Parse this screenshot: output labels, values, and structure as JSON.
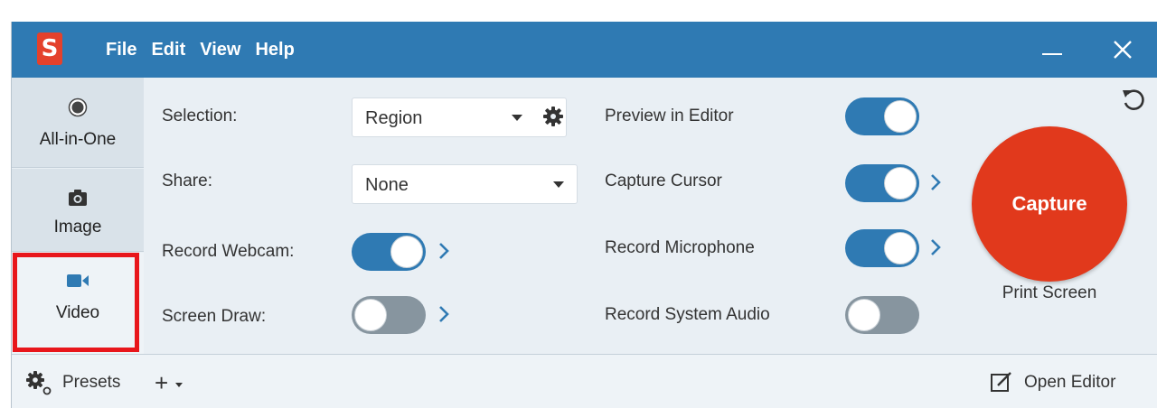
{
  "titlebar": {
    "logo": "S",
    "menu": [
      "File",
      "Edit",
      "View",
      "Help"
    ],
    "minimize_icon": "minimize-icon",
    "close_icon": "close-icon",
    "color": "#2f7ab3"
  },
  "modes": {
    "items": [
      {
        "label": "All-in-One",
        "icon": "record-dot-icon"
      },
      {
        "label": "Image",
        "icon": "camera-icon"
      },
      {
        "label": "Video",
        "icon": "video-camera-icon",
        "selected": true
      }
    ],
    "highlight_color": "#e8161b"
  },
  "settings": {
    "selection": {
      "label": "Selection:",
      "value": "Region"
    },
    "share": {
      "label": "Share:",
      "value": "None"
    },
    "record_webcam": {
      "label": "Record Webcam:",
      "on": true
    },
    "screen_draw": {
      "label": "Screen Draw:",
      "on": false
    },
    "preview_in_editor": {
      "label": "Preview in Editor",
      "on": true
    },
    "capture_cursor": {
      "label": "Capture Cursor",
      "on": true
    },
    "record_microphone": {
      "label": "Record Microphone",
      "on": true
    },
    "record_system_audio": {
      "label": "Record System Audio",
      "on": false
    }
  },
  "capture": {
    "label": "Capture",
    "hotkey": "Print Screen",
    "color": "#e1391c"
  },
  "bottombar": {
    "presets_label": "Presets",
    "add_preset": "+",
    "open_editor_label": "Open Editor"
  }
}
